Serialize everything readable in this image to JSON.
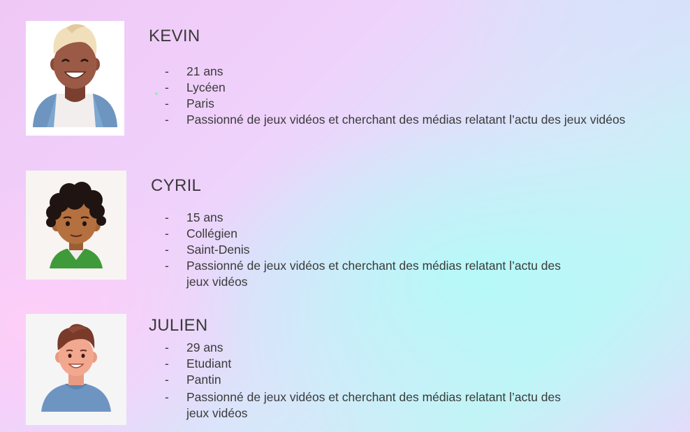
{
  "profiles": [
    {
      "name": "KEVIN",
      "details": [
        "21 ans",
        "Lycéen",
        "Paris",
        "Passionné de jeux vidéos et cherchant des médias relatant l’actu des jeux vidéos"
      ]
    },
    {
      "name": "CYRIL",
      "details": [
        "15 ans",
        "Collégien",
        "Saint-Denis",
        "Passionné de jeux vidéos et cherchant des médias relatant l’actu des",
        "jeux vidéos"
      ]
    },
    {
      "name": "JULIEN",
      "details": [
        "29 ans",
        "Etudiant",
        "Pantin",
        "Passionné de jeux vidéos et cherchant des médias relatant l’actu des",
        "jeux vidéos"
      ]
    }
  ]
}
